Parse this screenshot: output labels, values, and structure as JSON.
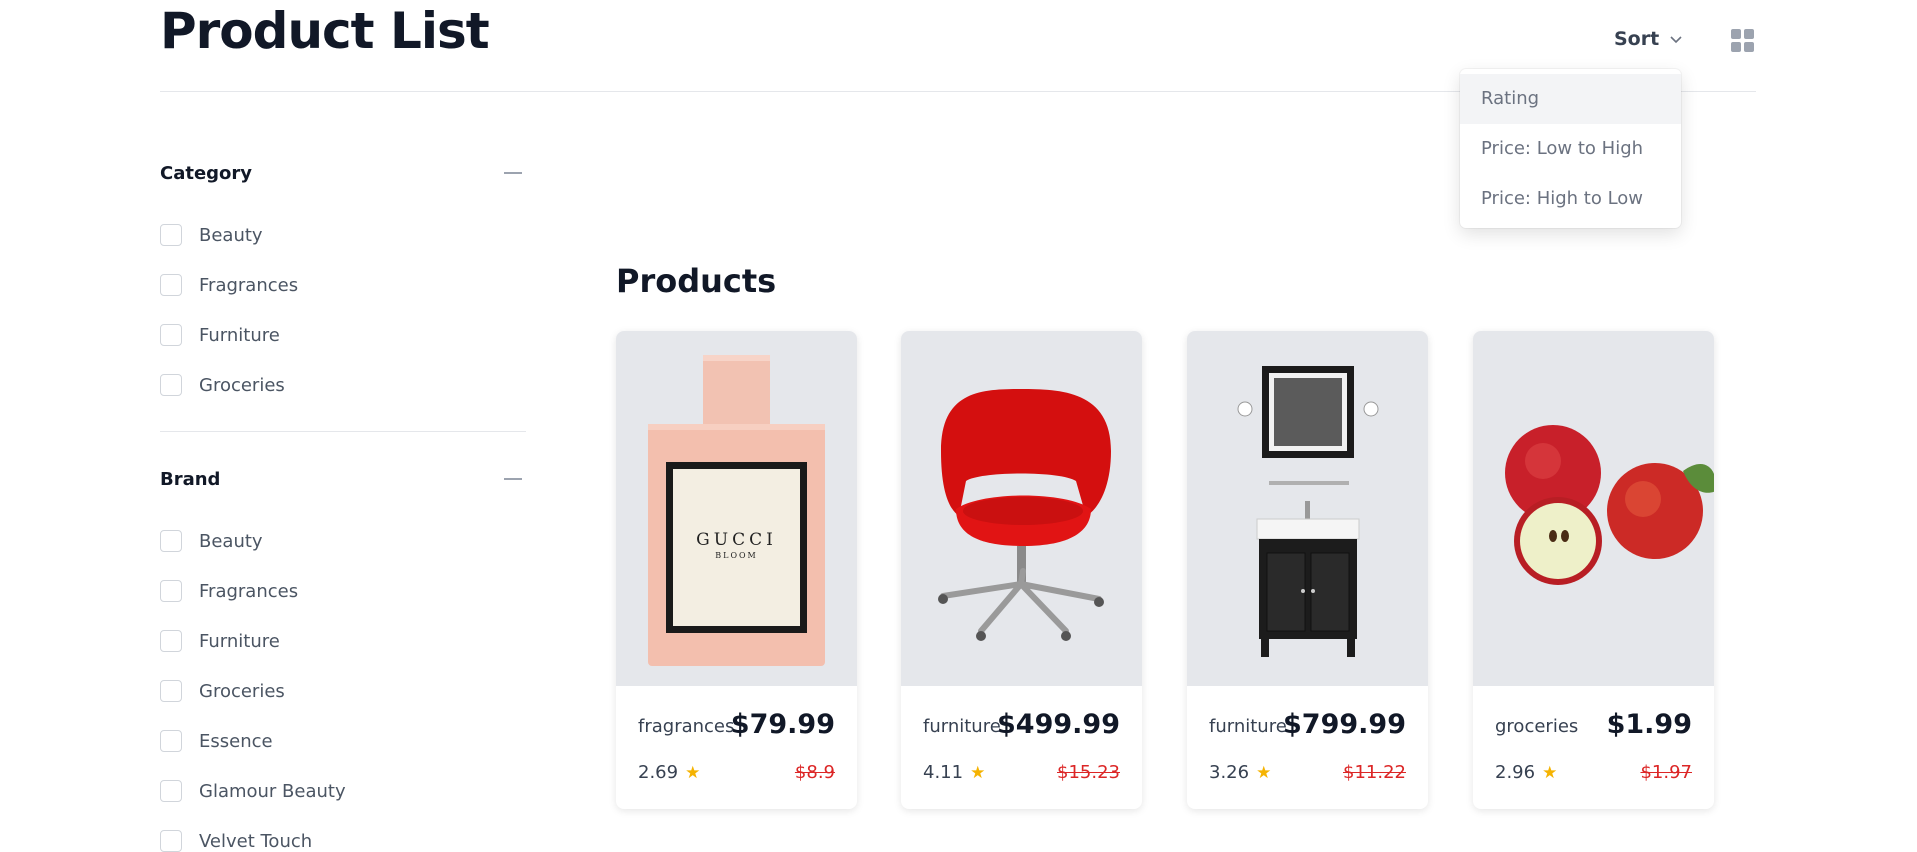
{
  "header": {
    "title": "Product List",
    "sort_label": "Sort"
  },
  "sort_menu": {
    "items": [
      {
        "label": "Rating",
        "active": true
      },
      {
        "label": "Price: Low to High"
      },
      {
        "label": "Price: High to Low"
      }
    ]
  },
  "filters": {
    "category": {
      "title": "Category",
      "options": [
        "Beauty",
        "Fragrances",
        "Furniture",
        "Groceries"
      ]
    },
    "brand": {
      "title": "Brand",
      "options": [
        "Beauty",
        "Fragrances",
        "Furniture",
        "Groceries",
        "Essence",
        "Glamour Beauty",
        "Velvet Touch"
      ]
    }
  },
  "products": {
    "heading": "Products",
    "items": [
      {
        "category": "fragrances",
        "price": "$79.99",
        "rating": "2.69",
        "old_price": "$8.9",
        "image": "perfume-bottle",
        "brand_text": "GUCCI",
        "product_text": "BLOOM"
      },
      {
        "category": "furniture",
        "price": "$499.99",
        "rating": "4.11",
        "old_price": "$15.23",
        "image": "red-office-chair"
      },
      {
        "category": "furniture",
        "price": "$799.99",
        "rating": "3.26",
        "old_price": "$11.22",
        "image": "bathroom-vanity"
      },
      {
        "category": "groceries",
        "price": "$1.99",
        "rating": "2.96",
        "old_price": "$1.97",
        "image": "apples"
      }
    ]
  },
  "colors": {
    "old_price": "#dc2626",
    "star": "#f5b301",
    "card_image_bg": "#e5e7eb"
  }
}
